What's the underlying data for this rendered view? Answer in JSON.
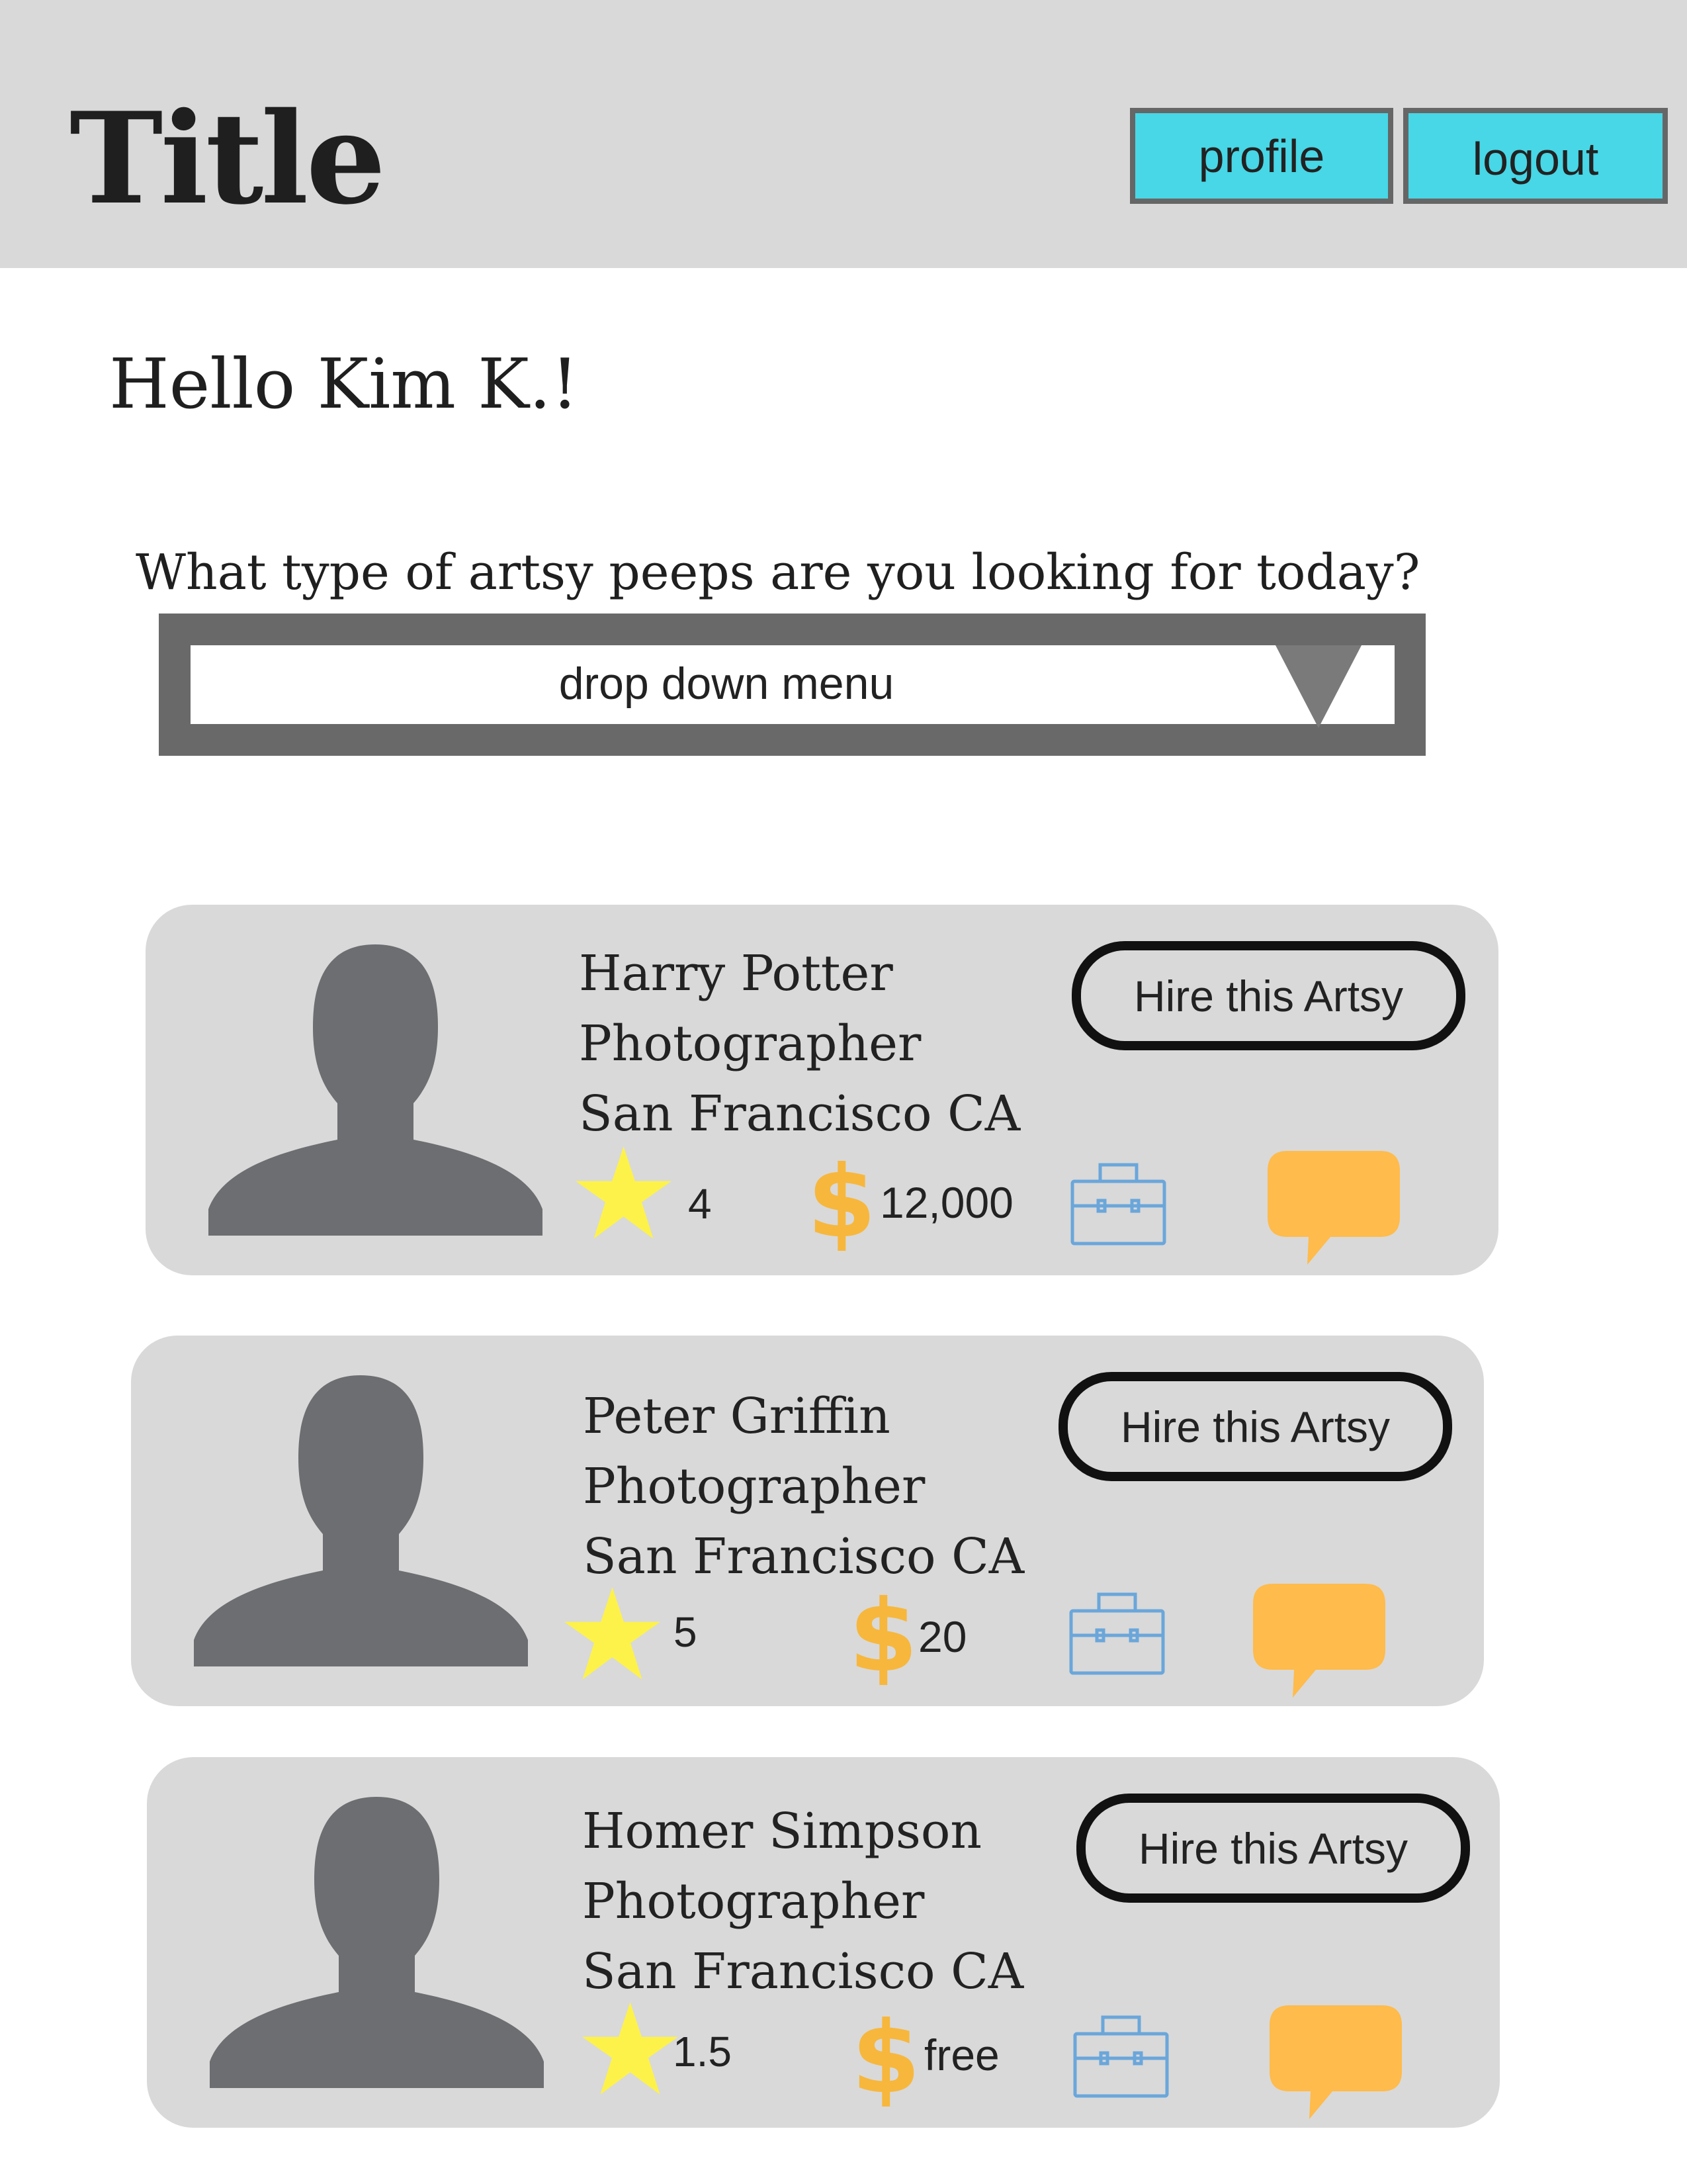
{
  "header": {
    "title": "Title",
    "profile_label": "profile",
    "logout_label": "logout"
  },
  "greeting": "Hello Kim K.!",
  "search": {
    "question": "What type of artsy peeps are you looking for today?",
    "dropdown_value": "drop down menu"
  },
  "artists": [
    {
      "name": "Harry Potter",
      "role": "Photographer",
      "location": "San Francisco CA",
      "rating": "4",
      "price": "12,000",
      "hire_label": "Hire this Artsy"
    },
    {
      "name": "Peter Griffin",
      "role": "Photographer",
      "location": "San Francisco CA",
      "rating": "5",
      "price": "20",
      "hire_label": "Hire this Artsy"
    },
    {
      "name": "Homer Simpson",
      "role": "Photographer",
      "location": "San Francisco CA",
      "rating": "1.5",
      "price": "free",
      "hire_label": "Hire this Artsy"
    }
  ],
  "icons": {
    "avatar": "person-silhouette-icon",
    "rating": "star-icon",
    "price": "dollar-icon",
    "portfolio": "briefcase-icon",
    "message": "chat-bubble-icon",
    "dropdown": "triangle-down-icon"
  },
  "colors": {
    "header_bg": "#d9d9d9",
    "button_accent": "#47d7e6",
    "card_bg": "#d9d9d9",
    "avatar": "#6d6e71",
    "star": "#fdf24a",
    "dollar": "#f7b73c",
    "briefcase": "#6aa6da",
    "chat": "#ffbb4b"
  }
}
